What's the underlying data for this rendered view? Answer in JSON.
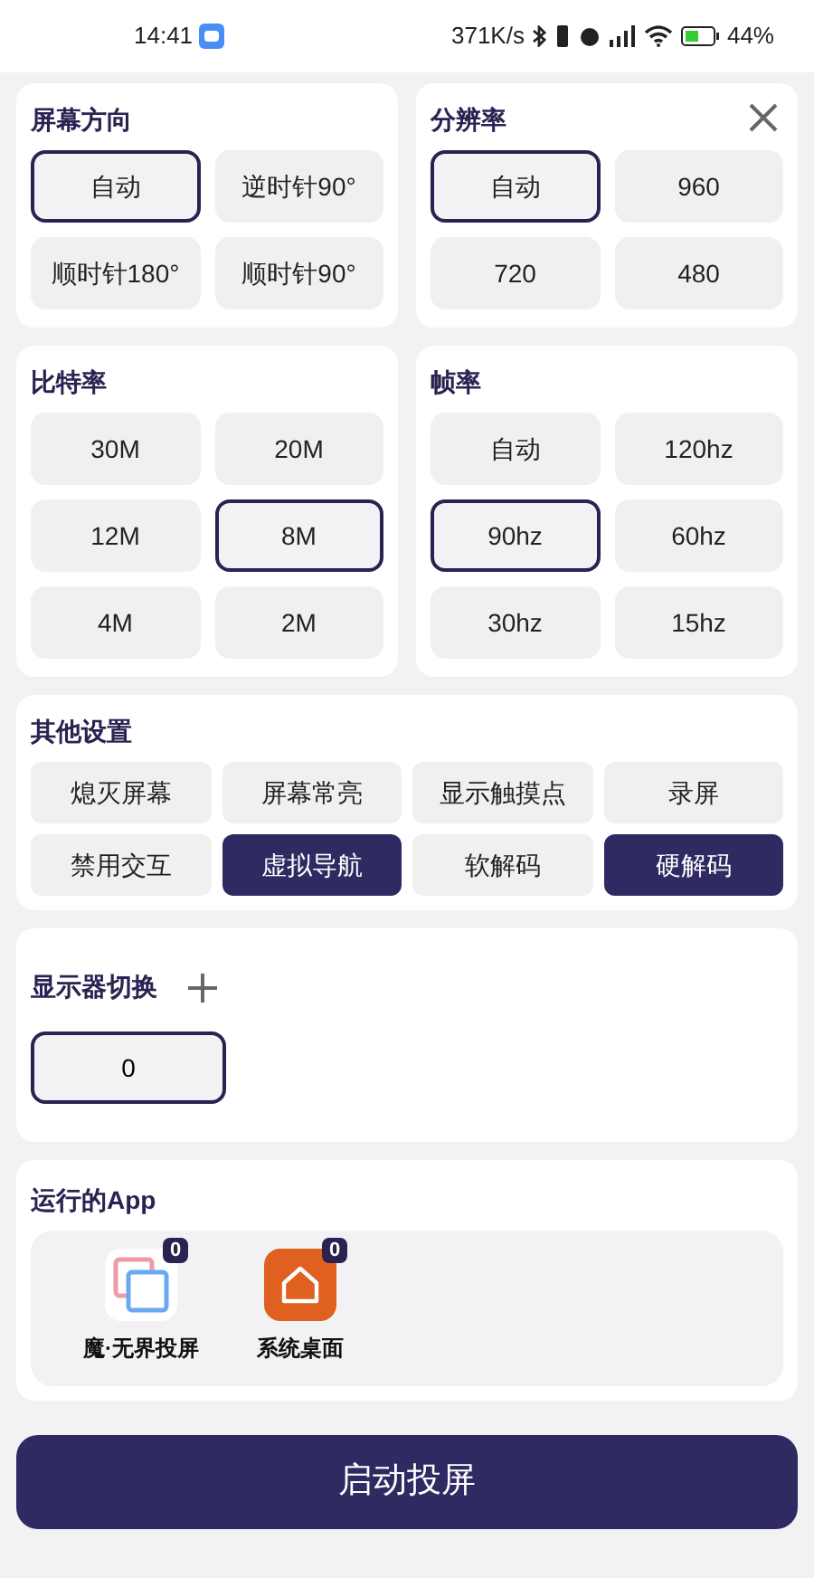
{
  "status_bar": {
    "time": "14:41",
    "speed": "371K/s",
    "battery": "44%"
  },
  "orientation": {
    "title": "屏幕方向",
    "options": [
      {
        "label": "自动",
        "selected": true
      },
      {
        "label": "逆时针90°",
        "selected": false
      },
      {
        "label": "顺时针180°",
        "selected": false
      },
      {
        "label": "顺时针90°",
        "selected": false
      }
    ]
  },
  "resolution": {
    "title": "分辨率",
    "options": [
      {
        "label": "自动",
        "selected": true
      },
      {
        "label": "960",
        "selected": false
      },
      {
        "label": "720",
        "selected": false
      },
      {
        "label": "480",
        "selected": false
      }
    ]
  },
  "bitrate": {
    "title": "比特率",
    "options": [
      {
        "label": "30M",
        "selected": false
      },
      {
        "label": "20M",
        "selected": false
      },
      {
        "label": "12M",
        "selected": false
      },
      {
        "label": "8M",
        "selected": true
      },
      {
        "label": "4M",
        "selected": false
      },
      {
        "label": "2M",
        "selected": false
      }
    ]
  },
  "framerate": {
    "title": "帧率",
    "options": [
      {
        "label": "自动",
        "selected": false
      },
      {
        "label": "120hz",
        "selected": false
      },
      {
        "label": "90hz",
        "selected": true
      },
      {
        "label": "60hz",
        "selected": false
      },
      {
        "label": "30hz",
        "selected": false
      },
      {
        "label": "15hz",
        "selected": false
      }
    ]
  },
  "other_settings": {
    "title": "其他设置",
    "toggles": [
      {
        "label": "熄灭屏幕",
        "on": false
      },
      {
        "label": "屏幕常亮",
        "on": false
      },
      {
        "label": "显示触摸点",
        "on": false
      },
      {
        "label": "录屏",
        "on": false
      },
      {
        "label": "禁用交互",
        "on": false
      },
      {
        "label": "虚拟导航",
        "on": true
      },
      {
        "label": "软解码",
        "on": false
      },
      {
        "label": "硬解码",
        "on": true
      }
    ]
  },
  "display_switch": {
    "title": "显示器切换",
    "displays": [
      {
        "label": "0",
        "selected": true
      }
    ]
  },
  "running_apps": {
    "title": "运行的App",
    "apps": [
      {
        "name": "魔·无界投屏",
        "badge": "0",
        "kind": "mirror"
      },
      {
        "name": "系统桌面",
        "badge": "0",
        "kind": "home"
      }
    ]
  },
  "start_button": "启动投屏"
}
